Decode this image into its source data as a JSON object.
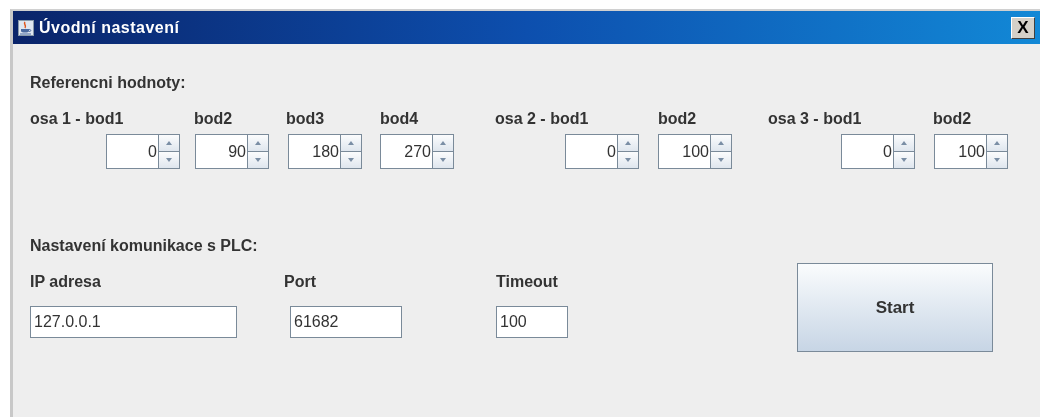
{
  "window": {
    "title": "Úvodní nastavení",
    "close": "X"
  },
  "reference": {
    "heading": "Referencni hodnoty:",
    "spinners": [
      {
        "label": "osa 1 - bod1",
        "value": "0"
      },
      {
        "label": "bod2",
        "value": "90"
      },
      {
        "label": "bod3",
        "value": "180"
      },
      {
        "label": "bod4",
        "value": "270"
      },
      {
        "label": "osa 2 - bod1",
        "value": "0"
      },
      {
        "label": "bod2",
        "value": "100"
      },
      {
        "label": "osa 3 - bod1",
        "value": "0"
      },
      {
        "label": "bod2",
        "value": "100"
      }
    ]
  },
  "communication": {
    "heading": "Nastavení komunikace s PLC:",
    "fields": [
      {
        "label": "IP adresa",
        "value": "127.0.0.1"
      },
      {
        "label": "Port",
        "value": "61682"
      },
      {
        "label": "Timeout",
        "value": "100"
      }
    ],
    "button": "Start"
  }
}
